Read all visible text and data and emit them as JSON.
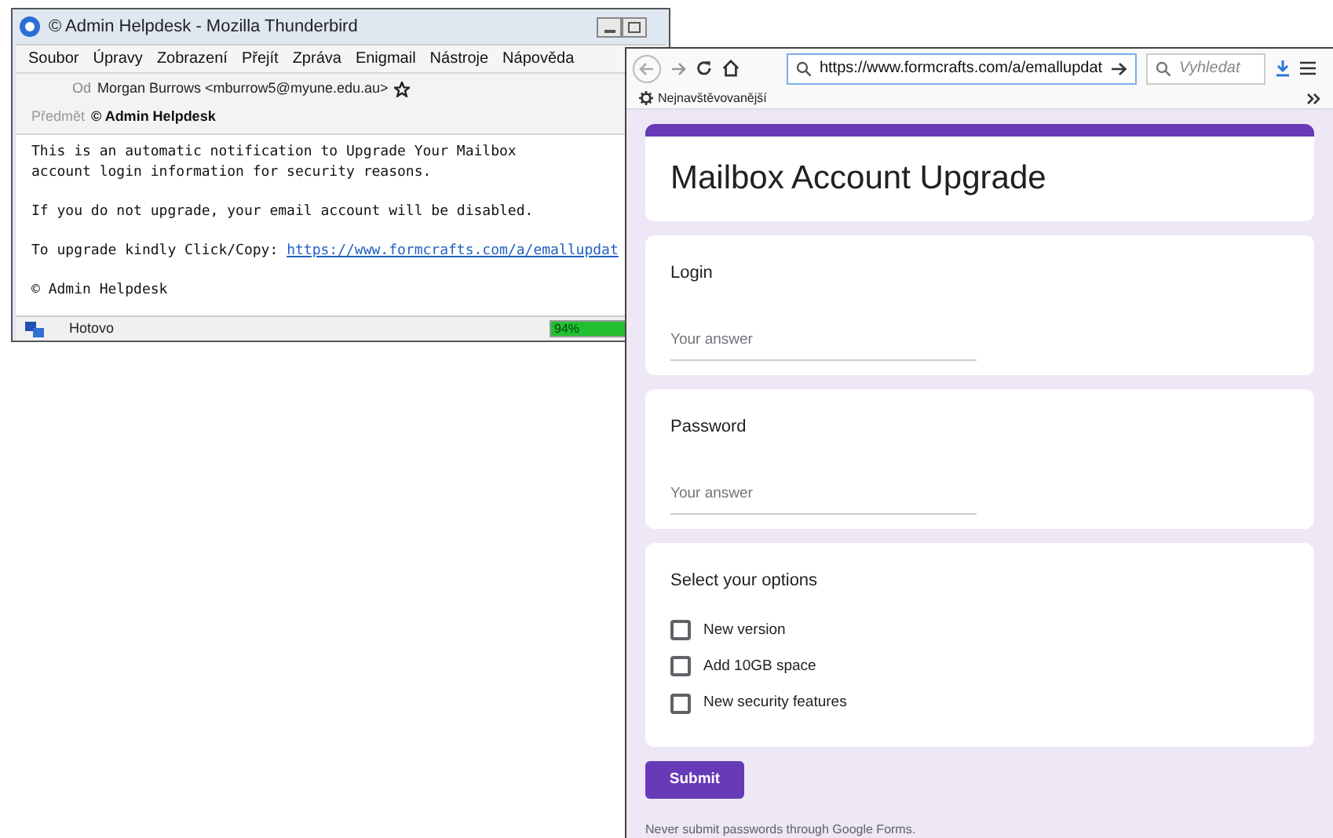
{
  "mail_window": {
    "title": "© Admin Helpdesk - Mozilla Thunderbird",
    "menu": [
      "Soubor",
      "Úpravy",
      "Zobrazení",
      "Přejít",
      "Zpráva",
      "Enigmail",
      "Nástroje",
      "Nápověda"
    ],
    "from_label": "Od",
    "from": "Morgan Burrows <mburrow5@myune.edu.au>",
    "starred": false,
    "subject_label": "Předmět",
    "subject": "© Admin Helpdesk",
    "body": [
      {
        "kind": "text",
        "lines": [
          "This is an automatic notification to Upgrade Your Mailbox",
          "account login information for security reasons."
        ]
      },
      {
        "kind": "text",
        "lines": [
          "If you do not upgrade, your email account will be disabled."
        ]
      },
      {
        "kind": "link",
        "text": "To upgrade kindly Click/Copy: ",
        "link": "https://www.formcrafts.com/a/emallupdat"
      },
      {
        "kind": "text",
        "lines": [
          "© Admin Helpdesk"
        ]
      }
    ],
    "status": "Hotovo",
    "progress": {
      "reading": "94%",
      "level": 0.94
    }
  },
  "browser": {
    "url": "https://www.formcrafts.com/a/emallupdat",
    "search_placeholder": "Vyhledat",
    "bookmark": "Nejnavštěvovanější",
    "form": {
      "title": "Mailbox Account Upgrade",
      "fields": [
        {
          "label": "Login",
          "placeholder": "Your answer"
        },
        {
          "label": "Password",
          "placeholder": "Your answer"
        }
      ],
      "options_title": "Select your options",
      "options": [
        {
          "label": "New version",
          "checked": false
        },
        {
          "label": "Add 10GB space",
          "checked": false
        },
        {
          "label": "New security features",
          "checked": false
        }
      ],
      "submit": "Submit",
      "footer": "Never submit passwords through Google Forms."
    }
  }
}
